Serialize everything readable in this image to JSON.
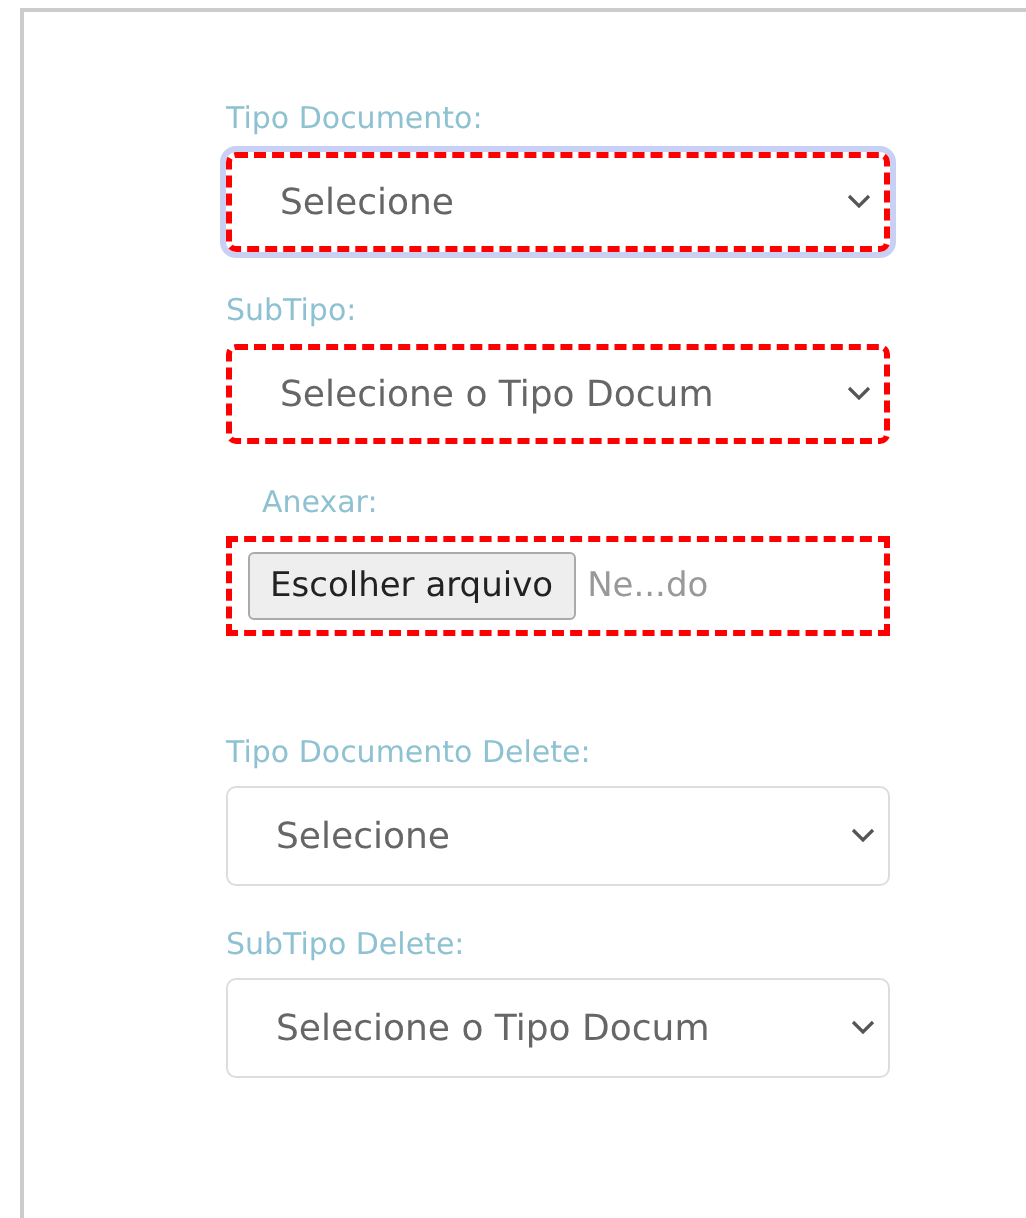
{
  "sections": [
    {
      "fields": [
        {
          "kind": "select",
          "label": "Tipo Documento:",
          "value": "Selecione",
          "highlighted": true,
          "focused": true
        },
        {
          "kind": "select",
          "label": "SubTipo:",
          "value": "Selecione o Tipo Docum",
          "highlighted": true,
          "focused": false
        },
        {
          "kind": "file",
          "label": "Anexar:",
          "button": "Escolher arquivo",
          "filename": "Ne...do",
          "highlighted": true,
          "focused": false
        }
      ]
    },
    {
      "fields": [
        {
          "kind": "select",
          "label": "Tipo Documento Delete:",
          "value": "Selecione",
          "highlighted": false,
          "focused": false
        },
        {
          "kind": "select",
          "label": "SubTipo Delete:",
          "value": "Selecione o Tipo Docum",
          "highlighted": false,
          "focused": false
        }
      ]
    }
  ]
}
